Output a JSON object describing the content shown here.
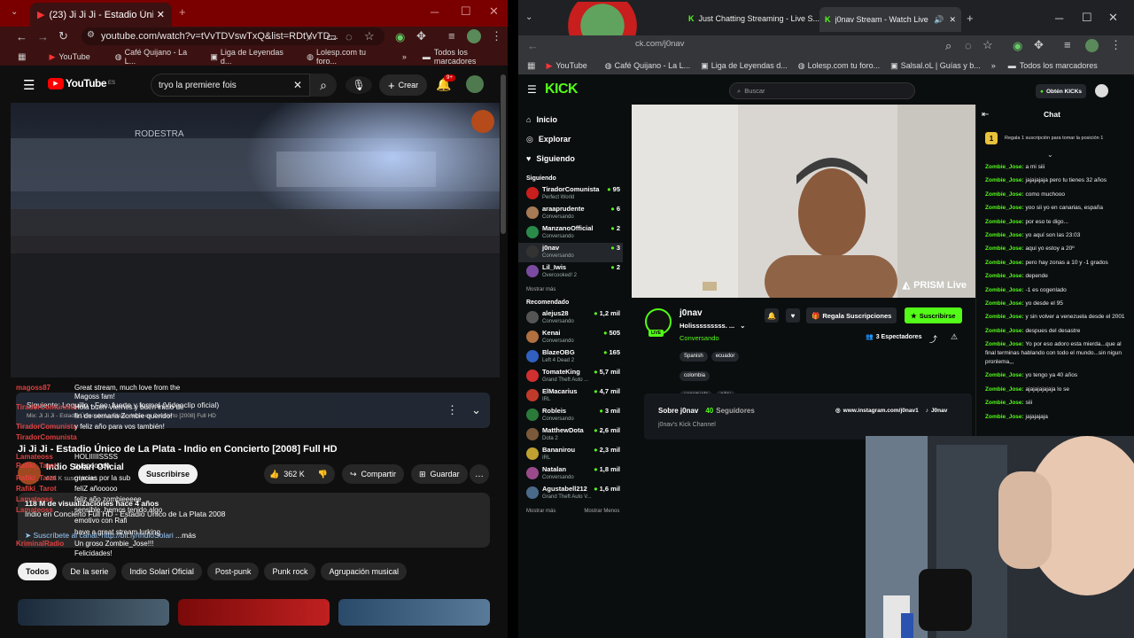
{
  "left": {
    "tab_title": "(23) Ji Ji Ji - Estadio Único de L...",
    "url": "youtube.com/watch?v=tVvTDVswTxQ&list=RDtVvTD...",
    "bookmarks": [
      "YouTube",
      "Café Quijano - La L...",
      "Liga de Leyendas d...",
      "Lolesp.com tu foro...",
      "»",
      "Todos los marcadores"
    ],
    "youtube": {
      "logo": "YouTube",
      "region": "ES",
      "search_value": "tryo la premiere fois",
      "create_label": "Crear",
      "notif_count": "9+"
    },
    "next_up": {
      "label": "Siguiente: Loquillo - Feo, fuerte y formal (Videoclip oficial)",
      "mix": "Mix: Ji Ji Ji - Estadio Único de La Plata - Indio en Concierto [2008] Full HD"
    },
    "video_title": "Ji Ji Ji - Estadio Único de La Plata - Indio en Concierto [2008] Full HD",
    "channel": {
      "name": "Indio Solari Oficial",
      "subs": "628 K suscriptores",
      "subscribe": "Suscribirse"
    },
    "likes": "362 K",
    "share": "Compartir",
    "save": "Guardar",
    "description": {
      "stats": "118 M de visualizaciones  hace 4 años",
      "line2": "Indio en Concierto Full HD - Estadio Unico de La Plata 2008",
      "line3": "➤ Suscríbete al canal: http://bit.ly/IndioSolari",
      "more": "...más"
    },
    "chips": [
      "Todos",
      "De la serie",
      "Indio Solari Oficial",
      "Post-punk",
      "Punk rock",
      "Agrupación musical"
    ],
    "overlay_chat": [
      {
        "user": "magoss87",
        "text": "Great stream, much love from the"
      },
      {
        "user": "",
        "text": "Magoss fam!"
      },
      {
        "user": "TiradorComunista",
        "text": "Hola buen Viernes y buen inicio de"
      },
      {
        "user": "",
        "text": "fin de semana Zombie querido!"
      },
      {
        "user": "TiradorComunista",
        "text": "y feliz año para vos también!"
      },
      {
        "user": "TiradorComunista",
        "text": ""
      },
      {
        "user": "Lamateoss",
        "text": "HOLIIIIISSSS"
      },
      {
        "user": "Rafiki_Tarot",
        "text": "guapooooo"
      },
      {
        "user": "Rafiki_Tarot",
        "text": "gracias por la sub"
      },
      {
        "user": "Rafiki_Tarot",
        "text": "feliZ añooooo"
      },
      {
        "user": "Lamateoss",
        "text": "feliz año zombieeeee"
      },
      {
        "user": "Lamateoss",
        "text": "sensible. hemos tenido algo"
      },
      {
        "user": "",
        "text": "emotivo con Rafi"
      },
      {
        "user": "",
        "text": "have a great stream lurking"
      },
      {
        "user": "KriminalRadio",
        "text": "Un groso Zombie_Jose!!!"
      },
      {
        "user": "",
        "text": "Felicidades!"
      }
    ]
  },
  "right": {
    "tabs": [
      "Just Chatting Streaming - Live S...",
      "j0nav Stream - Watch Live o..."
    ],
    "url": "ck.com/j0nav",
    "bookmarks": [
      "YouTube",
      "Café Quijano - La L...",
      "Liga de Leyendas d...",
      "Lolesp.com tu foro...",
      "Salsal.oL | Guías y b...",
      "»",
      "Todos los marcadores"
    ],
    "kick": {
      "logo": "KICK",
      "search_placeholder": "Buscar",
      "get_kicks": "Obtén KICKs",
      "nav": [
        "Inicio",
        "Explorar",
        "Siguiendo"
      ],
      "following_title": "Siguiendo",
      "following": [
        {
          "name": "TiradorComunista",
          "cat": "Perfect World",
          "viewers": "95",
          "color": "#c81e1e"
        },
        {
          "name": "araaprudente",
          "cat": "Conversando",
          "viewers": "6",
          "color": "#a57a55"
        },
        {
          "name": "ManzanoOfficial",
          "cat": "Conversando",
          "viewers": "2",
          "color": "#2a8a4a"
        },
        {
          "name": "j0nav",
          "cat": "Conversando",
          "viewers": "3",
          "color": "#333"
        },
        {
          "name": "Lil_Iwis",
          "cat": "Overcooked! 2",
          "viewers": "2",
          "color": "#7a4aa0"
        }
      ],
      "show_more": "Mostrar más",
      "recommended_title": "Recomendado",
      "recommended": [
        {
          "name": "alejus28",
          "cat": "Conversando",
          "viewers": "1,2 mil",
          "color": "#555"
        },
        {
          "name": "Kenai",
          "cat": "Conversando",
          "viewers": "505",
          "color": "#b07040"
        },
        {
          "name": "BlazeOBG",
          "cat": "Left 4 Dead 2",
          "viewers": "165",
          "color": "#3060c0"
        },
        {
          "name": "TomateKing",
          "cat": "Grand Theft Auto ...",
          "viewers": "5,7 mil",
          "color": "#d03030"
        },
        {
          "name": "ElMacarius",
          "cat": "IRL",
          "viewers": "4,7 mil",
          "color": "#c03a2a"
        },
        {
          "name": "Robleis",
          "cat": "Conversando",
          "viewers": "3 mil",
          "color": "#2a7a3a"
        },
        {
          "name": "MatthewDota",
          "cat": "Dota 2",
          "viewers": "2,6 mil",
          "color": "#7a5a3a"
        },
        {
          "name": "Bananirou",
          "cat": "IRL",
          "viewers": "2,3 mil",
          "color": "#c0a030"
        },
        {
          "name": "Natalan",
          "cat": "Conversando",
          "viewers": "1,8 mil",
          "color": "#9a4a8a"
        },
        {
          "name": "Agustabell212",
          "cat": "Grand Theft Auto V...",
          "viewers": "1,6 mil",
          "color": "#4a6a8a"
        }
      ],
      "show_more2": "Mostrar más",
      "show_less": "Mostrar Menos",
      "streamer": {
        "name": "j0nav",
        "title": "Holisssssssss. ...",
        "category": "Conversando",
        "tags": [
          "Spanish",
          "ecuador",
          "colombia",
          "venezuela",
          "péru"
        ],
        "gift_subs": "Regala Suscripciones",
        "subscribe": "Suscribirse",
        "viewers": "3 Espectadores",
        "live": "LIVE"
      },
      "about": {
        "title": "Sobre j0nav",
        "followers_count": "40",
        "followers_label": "Seguidores",
        "channel_name": "j0nav's Kick Channel",
        "instagram": "www.instagram.com/j0nav1",
        "tiktok": "J0nav"
      },
      "prism": "PRISM Live",
      "chat_title": "Chat",
      "chat_gift": "Regala 1 suscripción para tomar la posición 1",
      "chat_gift_rank": "1",
      "chat_user": "Zombie_Jose:",
      "chat": [
        "a mi siii",
        "jajajajaja pero tu tienes 32 años",
        "como muchooo",
        "yoo sii yo en canarias, españa",
        "por eso te digo...",
        "yo aquí son las 23:03",
        "aqui yo estoy a 20º",
        "pero hay zonas a 10 y -1 grados",
        "depende",
        "-1 es cogenlado",
        "yo desde el 95",
        "y sin volver a venezuela desde el 2001",
        "despues del desastre",
        "Yo por eso adoro esta mierda...que al final terminas hablando con todo el mundo...sin nigun pronlema,,,",
        "yo tengo ya 40 años",
        "ajajajajajaja lo se",
        "siii",
        "jajajajaja"
      ]
    }
  }
}
